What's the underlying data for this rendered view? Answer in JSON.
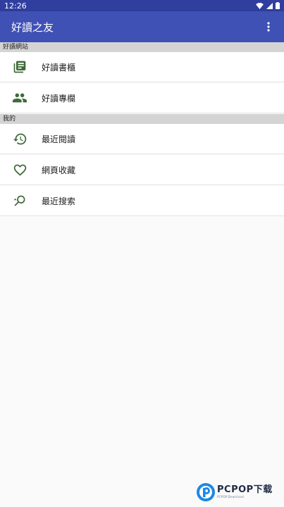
{
  "status_bar": {
    "time": "12:26",
    "icons": [
      "wifi-icon",
      "signal-icon",
      "battery-icon"
    ]
  },
  "app_bar": {
    "title": "好讀之友",
    "overflow_icon": "more-vert-icon"
  },
  "sections": [
    {
      "title": "好讀網站",
      "items": [
        {
          "icon": "book-library-icon",
          "label": "好讀書櫃"
        },
        {
          "icon": "people-icon",
          "label": "好讀專欄"
        }
      ]
    },
    {
      "title": "我的",
      "items": [
        {
          "icon": "history-icon",
          "label": "最近閱讀"
        },
        {
          "icon": "heart-outline-icon",
          "label": "網頁收藏"
        },
        {
          "icon": "search-history-icon",
          "label": "最近搜索"
        }
      ]
    }
  ],
  "watermark": {
    "brand": "PCPOP",
    "suffix": "下载",
    "sub": "PCPOP.Download"
  },
  "colors": {
    "status_bar": "#303f9f",
    "app_bar": "#3f51b5",
    "icon_green": "#3f6a3a",
    "section_bg": "#d4d4d4"
  }
}
